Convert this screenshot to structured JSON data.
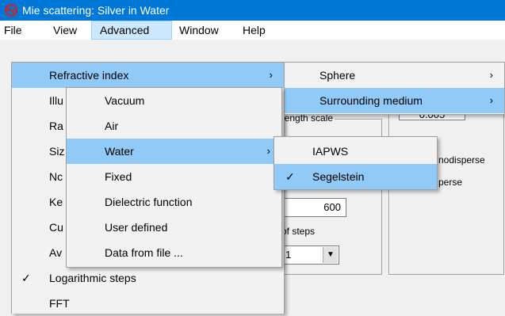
{
  "window": {
    "title": "Mie scattering:  Silver in Water"
  },
  "menubar": {
    "file": "File",
    "view": "View",
    "advanced": "Advanced",
    "window": "Window",
    "help": "Help"
  },
  "dialog": {
    "length_scale_label": "length scale",
    "value_top": "0.005",
    "monodisperse": "nodisperse",
    "polydisperse": "perse",
    "wavelength_value": "600",
    "steps_label": "of steps",
    "steps_value": "1"
  },
  "advanced_menu": {
    "refractive_index": "Refractive index",
    "illu": "Illu",
    "ra": "Ra",
    "siz": "Siz",
    "nc": "Nc",
    "ke": "Ke",
    "cu": "Cu",
    "av": "Av",
    "logarithmic_steps": "Logarithmic steps",
    "fft": "FFT"
  },
  "refractive_menu": {
    "sphere": "Sphere",
    "surrounding_medium": "Surrounding medium"
  },
  "medium_menu": {
    "vacuum": "Vacuum",
    "air": "Air",
    "water": "Water",
    "fixed": "Fixed",
    "dielectric_function": "Dielectric function",
    "user_defined": "User defined",
    "data_from_file": "Data from file ..."
  },
  "water_menu": {
    "iapws": "IAPWS",
    "segelstein": "Segelstein"
  },
  "glyphs": {
    "arrow": "›",
    "check": "✓",
    "dropdown": "▼"
  },
  "colors": {
    "titlebar": "#0078d7",
    "highlight": "#91c9f7",
    "menubar_active": "#cce8ff"
  }
}
